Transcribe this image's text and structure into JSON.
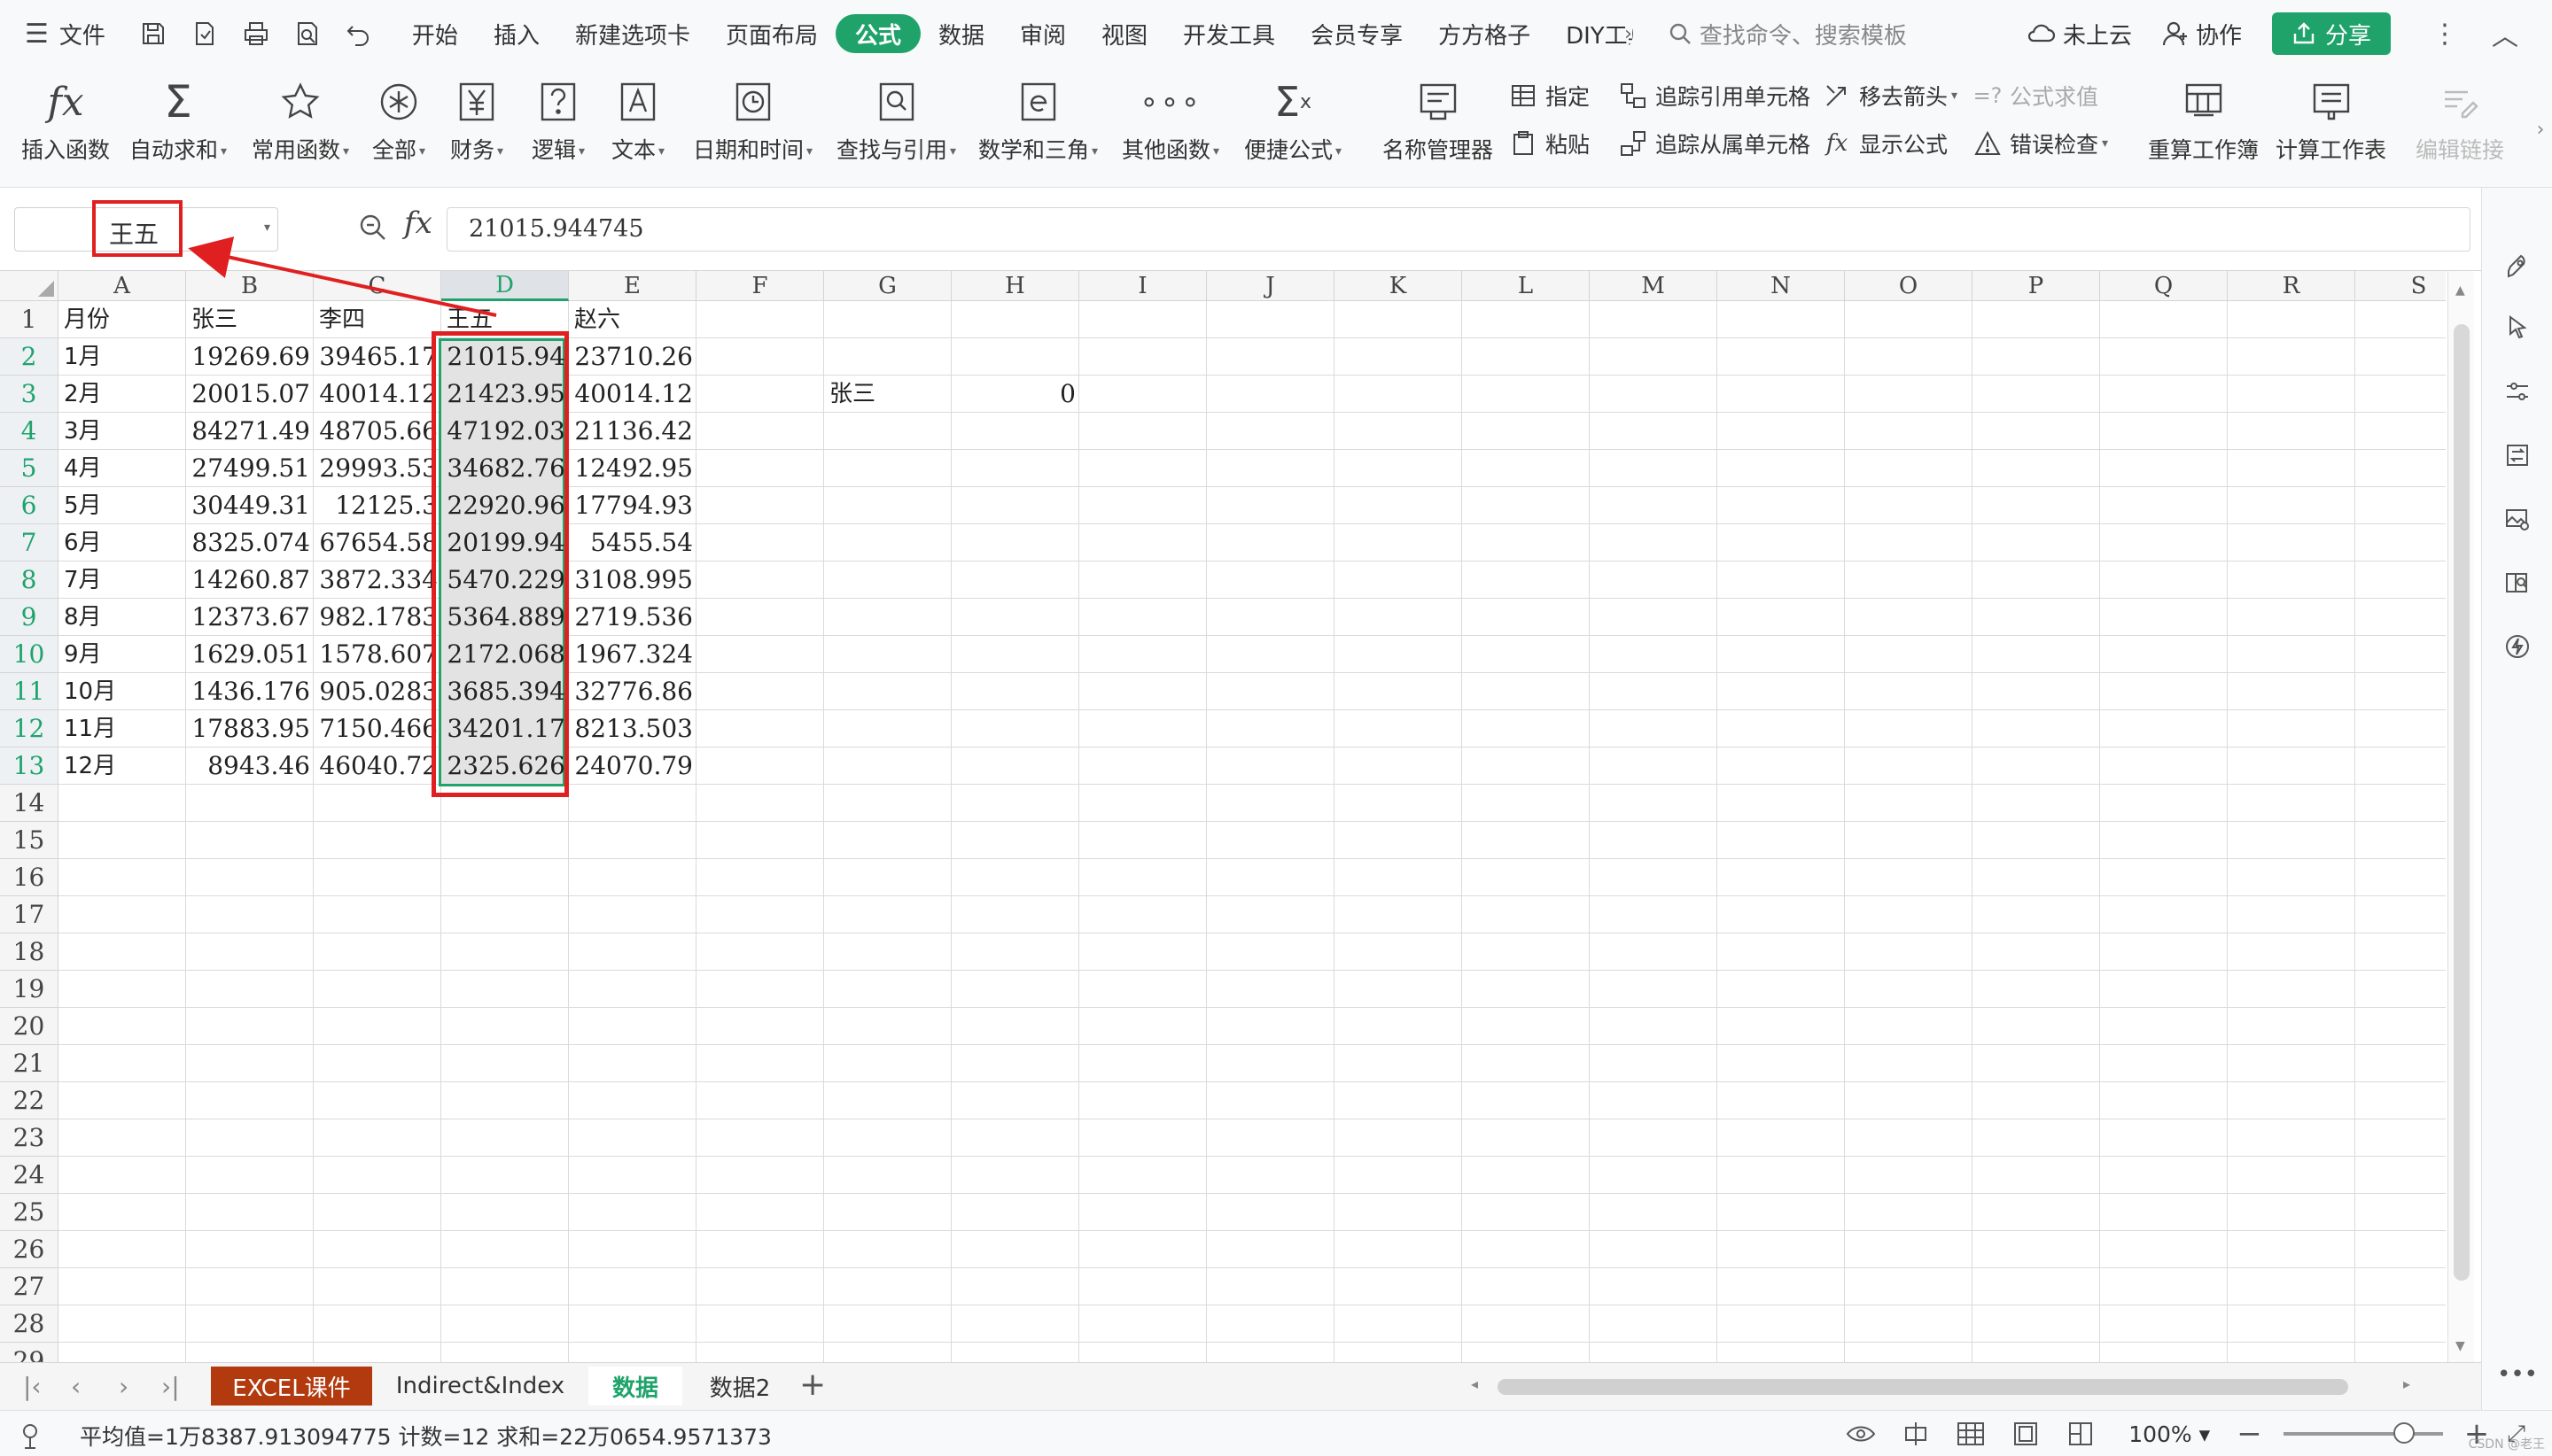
{
  "menu": {
    "file_label": "文件",
    "tabs": [
      "开始",
      "插入",
      "新建选项卡",
      "页面布局",
      "公式",
      "数据",
      "审阅",
      "视图",
      "开发工具",
      "会员专享",
      "方方格子",
      "DIY工具"
    ],
    "active_tab": "公式",
    "more": "›",
    "search_placeholder": "查找命令、搜索模板",
    "cloud": "未上云",
    "collab": "协作",
    "share": "分享"
  },
  "ribbon": {
    "insert_fn": "插入函数",
    "autosum": "自动求和",
    "common_fn": "常用函数",
    "all": "全部",
    "finance": "财务",
    "logic": "逻辑",
    "text": "文本",
    "datetime": "日期和时间",
    "lookup": "查找与引用",
    "math": "数学和三角",
    "other_fn": "其他函数",
    "quick_formula": "便捷公式",
    "name_manager": "名称管理器",
    "assign": "指定",
    "paste": "粘贴",
    "trace_precedents": "追踪引用单元格",
    "trace_dependents": "追踪从属单元格",
    "remove_arrows": "移去箭头",
    "show_formula": "显示公式",
    "eval_formula": "公式求值",
    "error_check": "错误检查",
    "recalc_book": "重算工作簿",
    "calc_sheet": "计算工作表",
    "edit_links": "编辑链接"
  },
  "formula_bar": {
    "name_box": "王五",
    "fx": "fx",
    "value": "21015.944745"
  },
  "columns": [
    "A",
    "B",
    "C",
    "D",
    "E",
    "F",
    "G",
    "H",
    "I",
    "J",
    "K",
    "L",
    "M",
    "N",
    "O",
    "P",
    "Q",
    "R",
    "S"
  ],
  "rows_count": 29,
  "selected_column": "D",
  "headers": [
    "月份",
    "张三",
    "李四",
    "王五",
    "赵六"
  ],
  "table": [
    [
      "1月",
      "19269.69",
      "39465.17",
      "21015.94",
      "23710.26"
    ],
    [
      "2月",
      "20015.07",
      "40014.12",
      "21423.95",
      "40014.12"
    ],
    [
      "3月",
      "84271.49",
      "48705.66",
      "47192.03",
      "21136.42"
    ],
    [
      "4月",
      "27499.51",
      "29993.53",
      "34682.76",
      "12492.95"
    ],
    [
      "5月",
      "30449.31",
      "12125.3",
      "22920.96",
      "17794.93"
    ],
    [
      "6月",
      "8325.074",
      "67654.58",
      "20199.94",
      "5455.54"
    ],
    [
      "7月",
      "14260.87",
      "3872.334",
      "5470.229",
      "3108.995"
    ],
    [
      "8月",
      "12373.67",
      "982.1783",
      "5364.889",
      "2719.536"
    ],
    [
      "9月",
      "1629.051",
      "1578.607",
      "2172.068",
      "1967.324"
    ],
    [
      "10月",
      "1436.176",
      "905.0283",
      "3685.394",
      "32776.86"
    ],
    [
      "11月",
      "17883.95",
      "7150.466",
      "34201.17",
      "8213.503"
    ],
    [
      "12月",
      "8943.46",
      "46040.72",
      "2325.626",
      "24070.79"
    ]
  ],
  "lookup": {
    "label": "张三",
    "value": "0"
  },
  "sheets": [
    "EXCEL课件",
    "Indirect&Index",
    "数据",
    "数据2"
  ],
  "active_sheet": "数据",
  "status": {
    "summary": "平均值=1万8387.913094775  计数=12  求和=22万0654.9571373",
    "zoom": "100%"
  },
  "watermark": "CSDN @老王"
}
